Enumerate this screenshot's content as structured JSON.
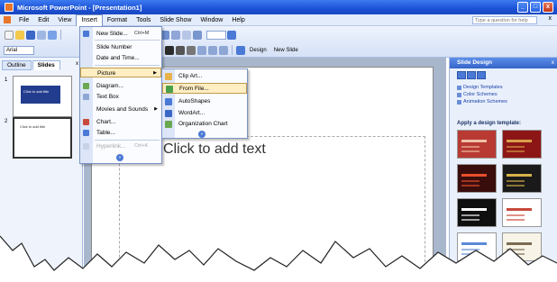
{
  "window": {
    "title": "Microsoft PowerPoint - [Presentation1]",
    "buttons": [
      "_",
      "□",
      "x"
    ]
  },
  "menubar": {
    "items": [
      "File",
      "Edit",
      "View",
      "Insert",
      "Format",
      "Tools",
      "Slide Show",
      "Window",
      "Help"
    ],
    "active": "Insert",
    "help_placeholder": "Type a question for help",
    "close": "x"
  },
  "toolbar": {
    "font_name": "Arial",
    "design_label": "Design",
    "new_slide_label": "New Slide"
  },
  "left_panel": {
    "tabs": [
      "Outline",
      "Slides"
    ],
    "active_tab": "Slides",
    "close": "x",
    "slides": [
      {
        "number": "1",
        "title": "Click to add title"
      },
      {
        "number": "2",
        "title": "Click to add title"
      }
    ]
  },
  "slide": {
    "placeholder_text": "Click to add text"
  },
  "insert_menu": {
    "items": [
      {
        "label": "New Slide...",
        "shortcut": "Ctrl+M",
        "icon": "new-slide-icon"
      },
      {
        "label": "Slide Number",
        "icon": ""
      },
      {
        "label": "Date and Time...",
        "icon": ""
      },
      {
        "label": "Picture",
        "submenu": true,
        "icon": ""
      },
      {
        "label": "Diagram...",
        "icon": "diagram-icon"
      },
      {
        "label": "Text Box",
        "icon": "textbox-icon"
      },
      {
        "label": "Movies and Sounds",
        "submenu": true,
        "icon": ""
      },
      {
        "label": "Chart...",
        "icon": "chart-icon"
      },
      {
        "label": "Table...",
        "icon": "table-icon"
      },
      {
        "label": "Hyperlink...",
        "shortcut": "Ctrl+K",
        "icon": "hyperlink-icon",
        "disabled": true
      }
    ],
    "highlighted": "Picture",
    "more": "»"
  },
  "picture_submenu": {
    "items": [
      {
        "label": "Clip Art...",
        "icon": "clipart-icon"
      },
      {
        "label": "From File...",
        "icon": "from-file-icon"
      },
      {
        "label": "AutoShapes",
        "icon": "autoshapes-icon"
      },
      {
        "label": "WordArt...",
        "icon": "wordart-icon"
      },
      {
        "label": "Organization Chart",
        "icon": "org-chart-icon"
      }
    ],
    "highlighted": "From File...",
    "more": "»"
  },
  "task_pane": {
    "title": "Slide Design",
    "close": "x",
    "links": [
      "Design Templates",
      "Color Schemes",
      "Animation Schemes"
    ],
    "section_title": "Apply a design template:",
    "templates": [
      {
        "bg": "#b83a33",
        "accent": "#f0c0a8"
      },
      {
        "bg": "#8c1616",
        "accent": "#d9a04a"
      },
      {
        "bg": "#3a0d0d",
        "accent": "#e8502a"
      },
      {
        "bg": "#1a1a1a",
        "accent": "#d6b24a"
      },
      {
        "bg": "#0f0f0f",
        "accent": "#ffffff"
      },
      {
        "bg": "#ffffff",
        "accent": "#c8483a"
      },
      {
        "bg": "#ffffff",
        "accent": "#5a8ad6"
      },
      {
        "bg": "#f7f3e6",
        "accent": "#7a6a50"
      }
    ]
  },
  "colors": {
    "title_bar": "#1c52d6",
    "highlight": "#ffeec2",
    "slide_thumb_fill": "#233d8e"
  }
}
